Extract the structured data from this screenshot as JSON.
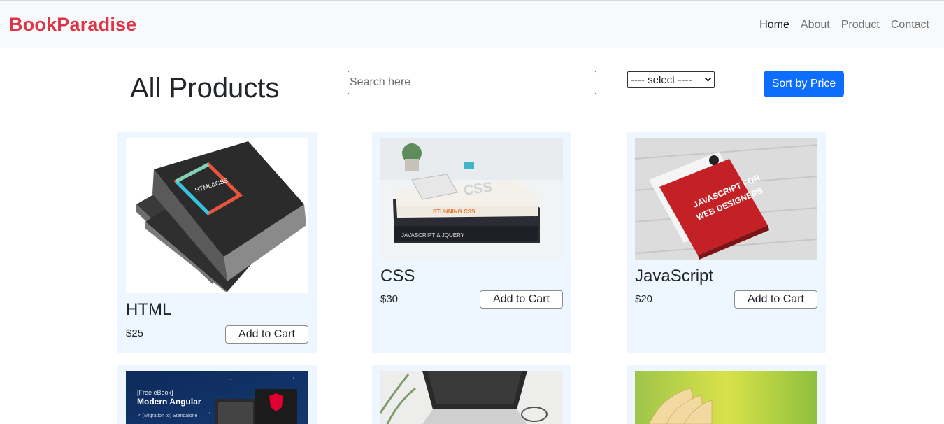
{
  "navbar": {
    "brand": "BookParadise",
    "links": [
      "Home",
      "About",
      "Product",
      "Contact"
    ]
  },
  "main": {
    "title": "All Products",
    "search_placeholder": "Search here",
    "select_value": "---- select ----",
    "sort_label": "Sort by Price"
  },
  "products": [
    {
      "name": "HTML",
      "price": "$25",
      "cart_label": "Add to Cart",
      "image": "html-css-book-image"
    },
    {
      "name": "CSS",
      "price": "$30",
      "cart_label": "Add to Cart",
      "image": "css-books-stack-image"
    },
    {
      "name": "JavaScript",
      "price": "$20",
      "cart_label": "Add to Cart",
      "image": "javascript-book-image"
    },
    {
      "name": "",
      "price": "",
      "cart_label": "",
      "image": "angular-ebook-image"
    },
    {
      "name": "",
      "price": "",
      "cart_label": "",
      "image": "laptop-desk-image"
    },
    {
      "name": "",
      "price": "",
      "cart_label": "",
      "image": "open-book-image"
    }
  ],
  "colors": {
    "brand": "#dc3545",
    "primary": "#0d6efd",
    "card_bg": "#eef7ff",
    "navbar_bg": "#f8f9fa"
  }
}
